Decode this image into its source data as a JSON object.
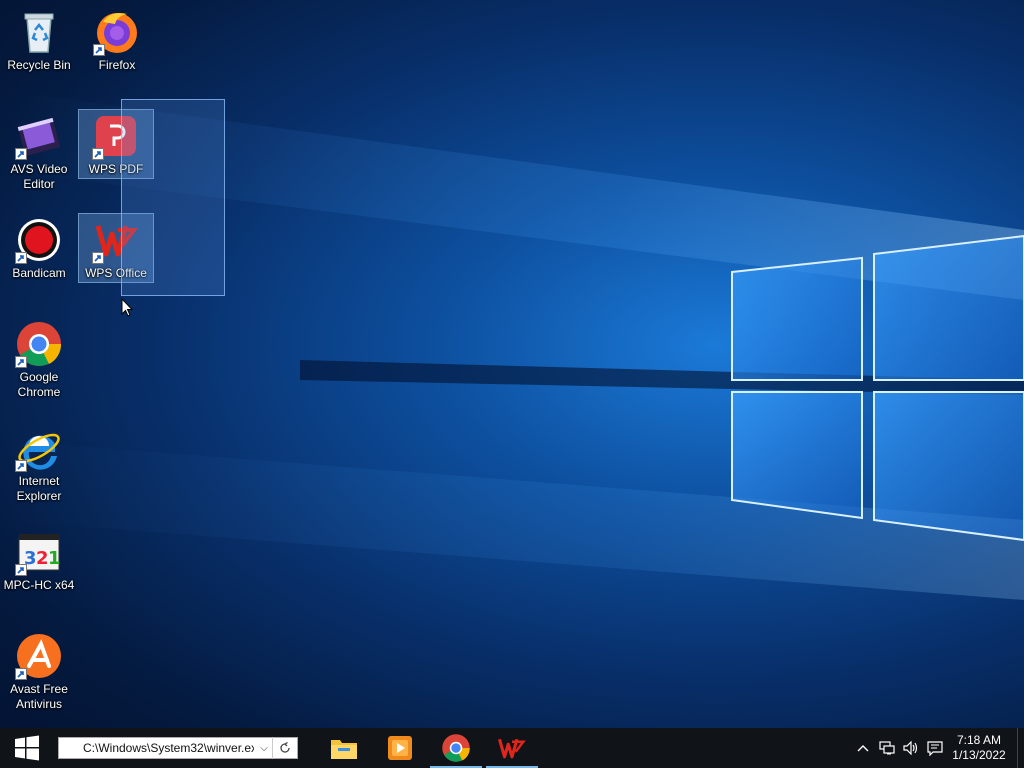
{
  "desktop": {
    "icons": [
      {
        "label": "Recycle Bin",
        "icon": "recycle-bin-icon"
      },
      {
        "label": "Firefox",
        "icon": "firefox-icon"
      },
      {
        "label": "AVS Video Editor",
        "icon": "avs-video-editor-icon"
      },
      {
        "label": "WPS PDF",
        "icon": "wps-pdf-icon"
      },
      {
        "label": "Bandicam",
        "icon": "bandicam-icon"
      },
      {
        "label": "WPS Office",
        "icon": "wps-office-icon"
      },
      {
        "label": "Google Chrome",
        "icon": "chrome-icon"
      },
      {
        "label": "Internet Explorer",
        "icon": "internet-explorer-icon"
      },
      {
        "label": "MPC-HC x64",
        "icon": "mpc-hc-icon"
      },
      {
        "label": "Avast Free Antivirus",
        "icon": "avast-icon"
      }
    ]
  },
  "taskbar": {
    "run_box_value": "C:\\Windows\\System32\\winver.ex",
    "pinned": [
      "file-explorer-icon",
      "media-player-icon",
      "chrome-icon",
      "wps-office-icon"
    ],
    "tray": [
      "chevron-up-icon",
      "network-icon",
      "volume-icon",
      "notification-icon"
    ],
    "clock": {
      "time": "7:18 AM",
      "date": "1/13/2022"
    }
  },
  "colors": {
    "taskbar": "#101418",
    "selection": "#5a96e6",
    "accent": "#76b9ed"
  }
}
